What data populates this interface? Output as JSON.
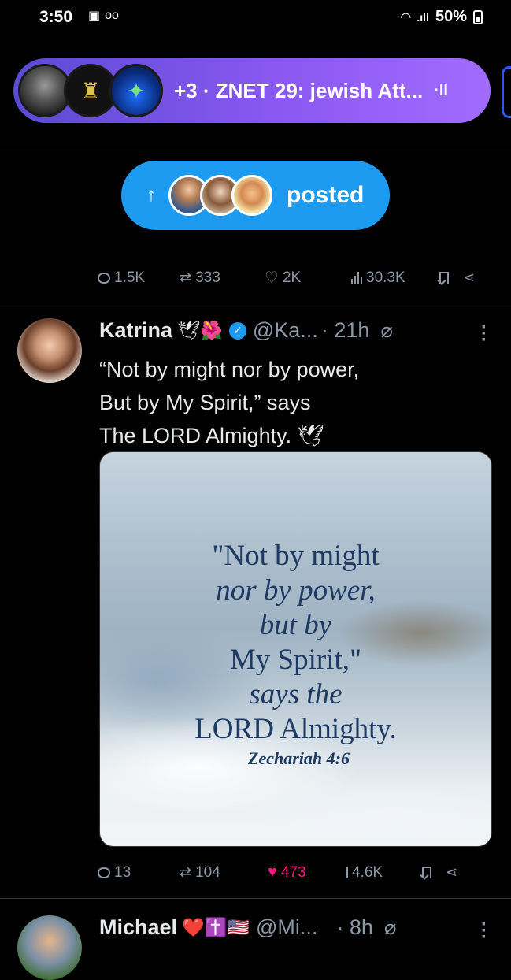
{
  "status_bar": {
    "time": "3:50",
    "left_icons": [
      "image-icon",
      "voicemail-icon"
    ],
    "battery": "50%"
  },
  "spaces": {
    "extra_count": "+3",
    "title": "· ZNET 29: jewish Att...",
    "pause_glyph": "·II"
  },
  "posted_pill": {
    "label": "posted"
  },
  "prev_tweet_actions": {
    "replies": "1.5K",
    "reposts": "333",
    "likes": "2K",
    "views": "30.3K"
  },
  "tweet": {
    "name": "Katrina",
    "name_emojis": "🕊🌺",
    "handle": "@Ka...",
    "time": "· 21h",
    "lines": [
      "“Not by might nor by power,",
      "But by My Spirit,” says",
      "The LORD Almighty. 🕊"
    ],
    "image_quote": {
      "lines": [
        "\"Not by might",
        "nor by power,",
        "but by",
        "My Spirit,\"",
        "says the",
        "LORD Almighty."
      ],
      "reference": "Zechariah 4:6"
    },
    "actions": {
      "replies": "13",
      "reposts": "104",
      "likes": "473",
      "views": "4.6K"
    }
  },
  "next_tweet": {
    "name": "Michael",
    "name_emojis": "❤️✝️🇺🇸",
    "handle": "@Mi...",
    "time": "· 8h"
  },
  "colors": {
    "accent": "#1d9bf0",
    "like": "#f91880",
    "spaces_start": "#5b4bd4",
    "spaces_end": "#a26bff"
  }
}
